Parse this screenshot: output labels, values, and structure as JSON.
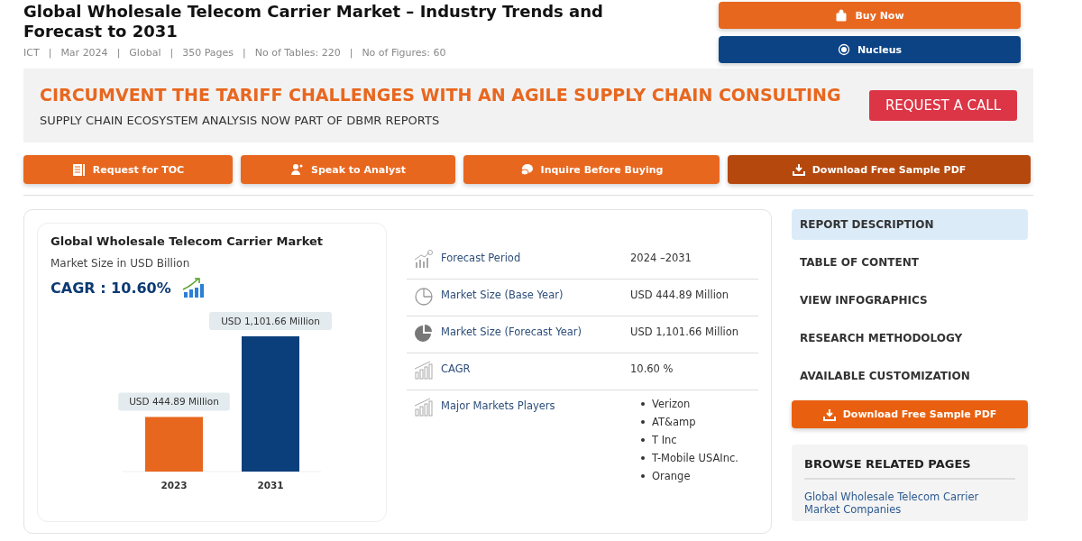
{
  "header": {
    "title": "Global Wholesale Telecom Carrier Market – Industry Trends and Forecast to 2031",
    "separator": "|",
    "meta": [
      "ICT",
      "Mar 2024",
      "Global",
      "350 Pages",
      "No of Tables: 220",
      "No of Figures: 60"
    ],
    "buttons": [
      {
        "label": "Buy Now",
        "kind": "buy"
      },
      {
        "label": "Nucleus",
        "kind": "nucleus"
      }
    ]
  },
  "banner": {
    "headline": "CIRCUMVENT THE TARIFF CHALLENGES WITH AN AGILE SUPPLY CHAIN CONSULTING",
    "subline": "SUPPLY CHAIN ECOSYSTEM ANALYSIS NOW PART OF DBMR REPORTS",
    "button": "REQUEST A CALL"
  },
  "actions": [
    {
      "label": "Request for TOC",
      "kind": "toc",
      "selected": false
    },
    {
      "label": "Speak to Analyst",
      "kind": "analyst",
      "selected": false
    },
    {
      "label": "Inquire Before Buying",
      "kind": "inquire",
      "selected": false
    },
    {
      "label": "Download Free Sample PDF",
      "kind": "download",
      "selected": true
    }
  ],
  "infographic": {
    "title": "Global Wholesale Telecom Carrier Market",
    "subtitle": "Market Size in USD Billion",
    "cagr": "CAGR : 10.60%",
    "chart_data": {
      "type": "bar",
      "categories": [
        "2023",
        "2031"
      ],
      "values": [
        444.89,
        1101.66
      ],
      "colors": [
        "#e8671f",
        "#0b3f7c"
      ],
      "value_labels": [
        "USD 444.89 Million",
        "USD 1,101.66 Million"
      ]
    }
  },
  "facts": [
    {
      "label": "Forecast Period",
      "kind": "forecast",
      "value": "2024 –2031"
    },
    {
      "label": "Market Size (Base Year)",
      "kind": "pie-outline",
      "value": "USD 444.89 Million"
    },
    {
      "label": "Market Size (Forecast Year)",
      "kind": "pie-filled",
      "value": "USD 1,101.66 Million"
    },
    {
      "label": "CAGR",
      "kind": "growth",
      "value": "10.60 %"
    },
    {
      "label": "Major Markets Players",
      "kind": "growth",
      "list": [
        "Verizon",
        "AT&amp",
        "T Inc",
        "T-Mobile USAInc.",
        "Orange"
      ]
    }
  ],
  "sidebar": {
    "items": [
      {
        "label": "REPORT DESCRIPTION",
        "selected": true
      },
      {
        "label": "TABLE OF CONTENT",
        "selected": false
      },
      {
        "label": "VIEW INFOGRAPHICS",
        "selected": false
      },
      {
        "label": "RESEARCH METHODOLOGY",
        "selected": false
      },
      {
        "label": "AVAILABLE CUSTOMIZATION",
        "selected": false
      }
    ],
    "download": "Download Free Sample PDF",
    "related": {
      "title": "BROWSE RELATED PAGES",
      "links": [
        "Global Wholesale Telecom Carrier Market Companies"
      ]
    }
  }
}
